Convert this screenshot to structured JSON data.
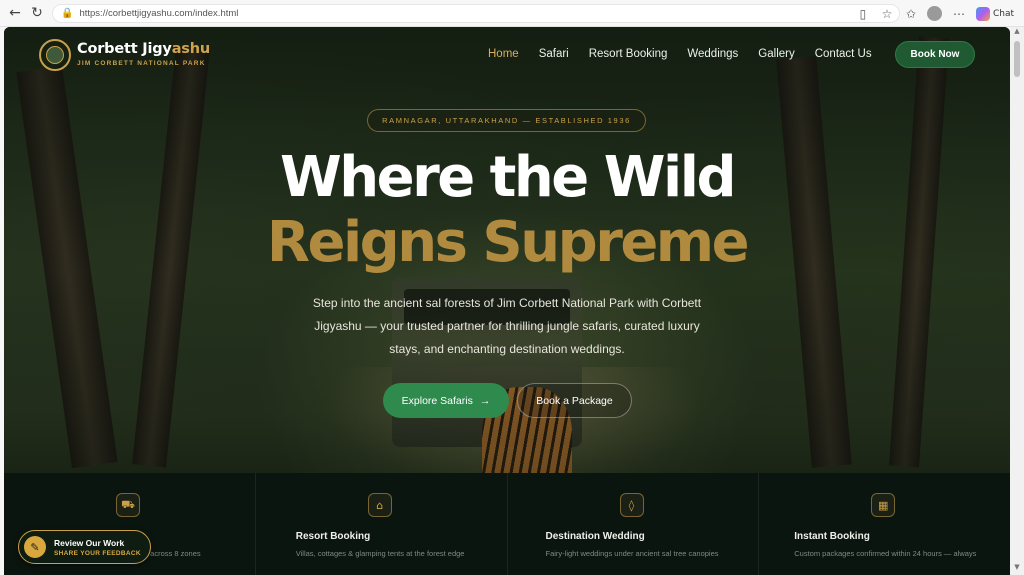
{
  "browser": {
    "url": "https://corbettjigyashu.com/index.html",
    "chat_label": "Chat",
    "icons": [
      "back-icon",
      "refresh-icon",
      "lock-icon",
      "reader-mode-icon",
      "favorite-icon",
      "favorites-list-icon",
      "profile-avatar",
      "more-icon",
      "copilot-icon"
    ]
  },
  "site": {
    "brand_main": "Corbett Jigy",
    "brand_accent": "ashu",
    "brand_sub": "JIM CORBETT NATIONAL PARK",
    "nav": [
      {
        "label": "Home"
      },
      {
        "label": "Safari"
      },
      {
        "label": "Resort Booking"
      },
      {
        "label": "Weddings"
      },
      {
        "label": "Gallery"
      },
      {
        "label": "Contact Us"
      }
    ],
    "book_now": "Book Now"
  },
  "hero": {
    "pill": "RAMNAGAR, UTTARAKHAND — ESTABLISHED 1936",
    "headline_1": "Where the Wild",
    "headline_2": "Reigns Supreme",
    "lead": "Step into the ancient sal forests of Jim Corbett National Park with Corbett Jigyashu — your trusted partner for thrilling jungle safaris, curated luxury stays, and enchanting destination weddings.",
    "cta_primary": "Explore Safaris",
    "cta_primary_arrow": "→",
    "cta_secondary": "Book a Package"
  },
  "features": [
    {
      "icon": "jeep-icon",
      "glyph": "⛟",
      "title": "",
      "desc": "aris across 8 zones"
    },
    {
      "icon": "home-icon",
      "glyph": "⌂",
      "title": "Resort Booking",
      "desc": "Villas, cottages & glamping tents at the forest edge"
    },
    {
      "icon": "drop-icon",
      "glyph": "◊",
      "title": "Destination Wedding",
      "desc": "Fairy-light weddings under ancient sal tree canopies"
    },
    {
      "icon": "calendar-icon",
      "glyph": "▦",
      "title": "Instant Booking",
      "desc": "Custom packages confirmed within 24 hours — always"
    }
  ],
  "review": {
    "title": "Review Our Work",
    "sub": "SHARE YOUR FEEDBACK"
  },
  "colors": {
    "gold": "#c9a14a",
    "green": "#2f8a4e",
    "dark": "#0b1510"
  }
}
